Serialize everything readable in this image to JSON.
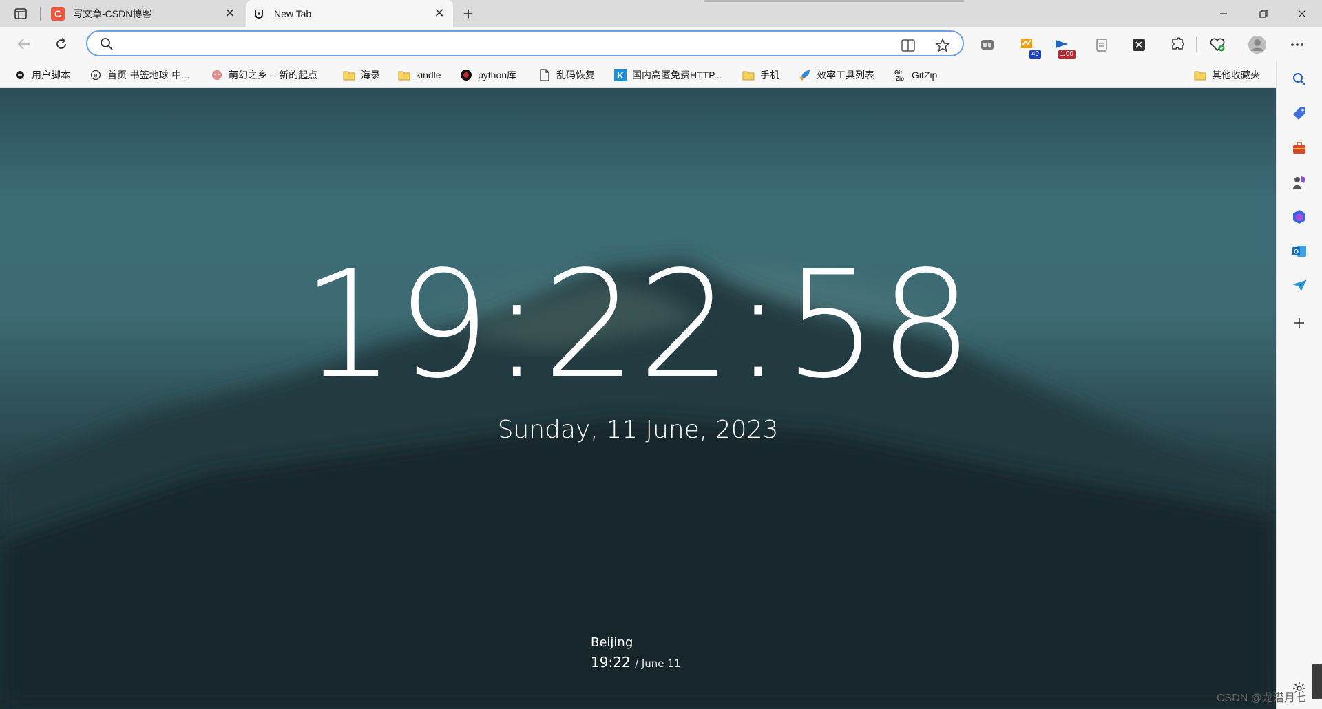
{
  "tabs": [
    {
      "title": "写文章-CSDN博客",
      "active": false
    },
    {
      "title": "New Tab",
      "active": true
    }
  ],
  "toolbar": {
    "search_placeholder": "",
    "extensions": [
      {
        "name": "extension-1"
      },
      {
        "name": "extension-2",
        "badge": "49",
        "badge_color": "#1a3fd8"
      },
      {
        "name": "extension-3",
        "badge": "1.00",
        "badge_color": "#c0262d"
      },
      {
        "name": "extension-4"
      },
      {
        "name": "extension-5"
      },
      {
        "name": "extensions"
      },
      {
        "name": "browser-essentials"
      },
      {
        "name": "profile"
      },
      {
        "name": "more"
      }
    ]
  },
  "bookmarks": [
    {
      "label": "用户脚本",
      "icon": "script-icon"
    },
    {
      "label": "首页-书签地球-中...",
      "icon": "site-icon"
    },
    {
      "label": "萌幻之乡 - -新的起点",
      "icon": "site-icon"
    },
    {
      "label": "海录",
      "icon": "folder-icon"
    },
    {
      "label": "kindle",
      "icon": "folder-icon"
    },
    {
      "label": "python库",
      "icon": "site-icon"
    },
    {
      "label": "乱码恢复",
      "icon": "page-icon"
    },
    {
      "label": "国内高匿免费HTTP...",
      "icon": "site-icon"
    },
    {
      "label": "手机",
      "icon": "folder-icon"
    },
    {
      "label": "效率工具列表",
      "icon": "rocket-icon"
    },
    {
      "label": "GitZip",
      "icon": "site-icon"
    }
  ],
  "other_bookmarks": "其他收藏夹",
  "clock": {
    "time": "19:22:58",
    "date": "Sunday, 11 June, 2023"
  },
  "world_clock": {
    "city": "Beijing",
    "time": "19:22",
    "date": "/ June 11"
  },
  "watermark": "CSDN @龙潜月七",
  "colors": {
    "address_border": "#6aa0e6",
    "csdn_red": "#f0553a"
  }
}
